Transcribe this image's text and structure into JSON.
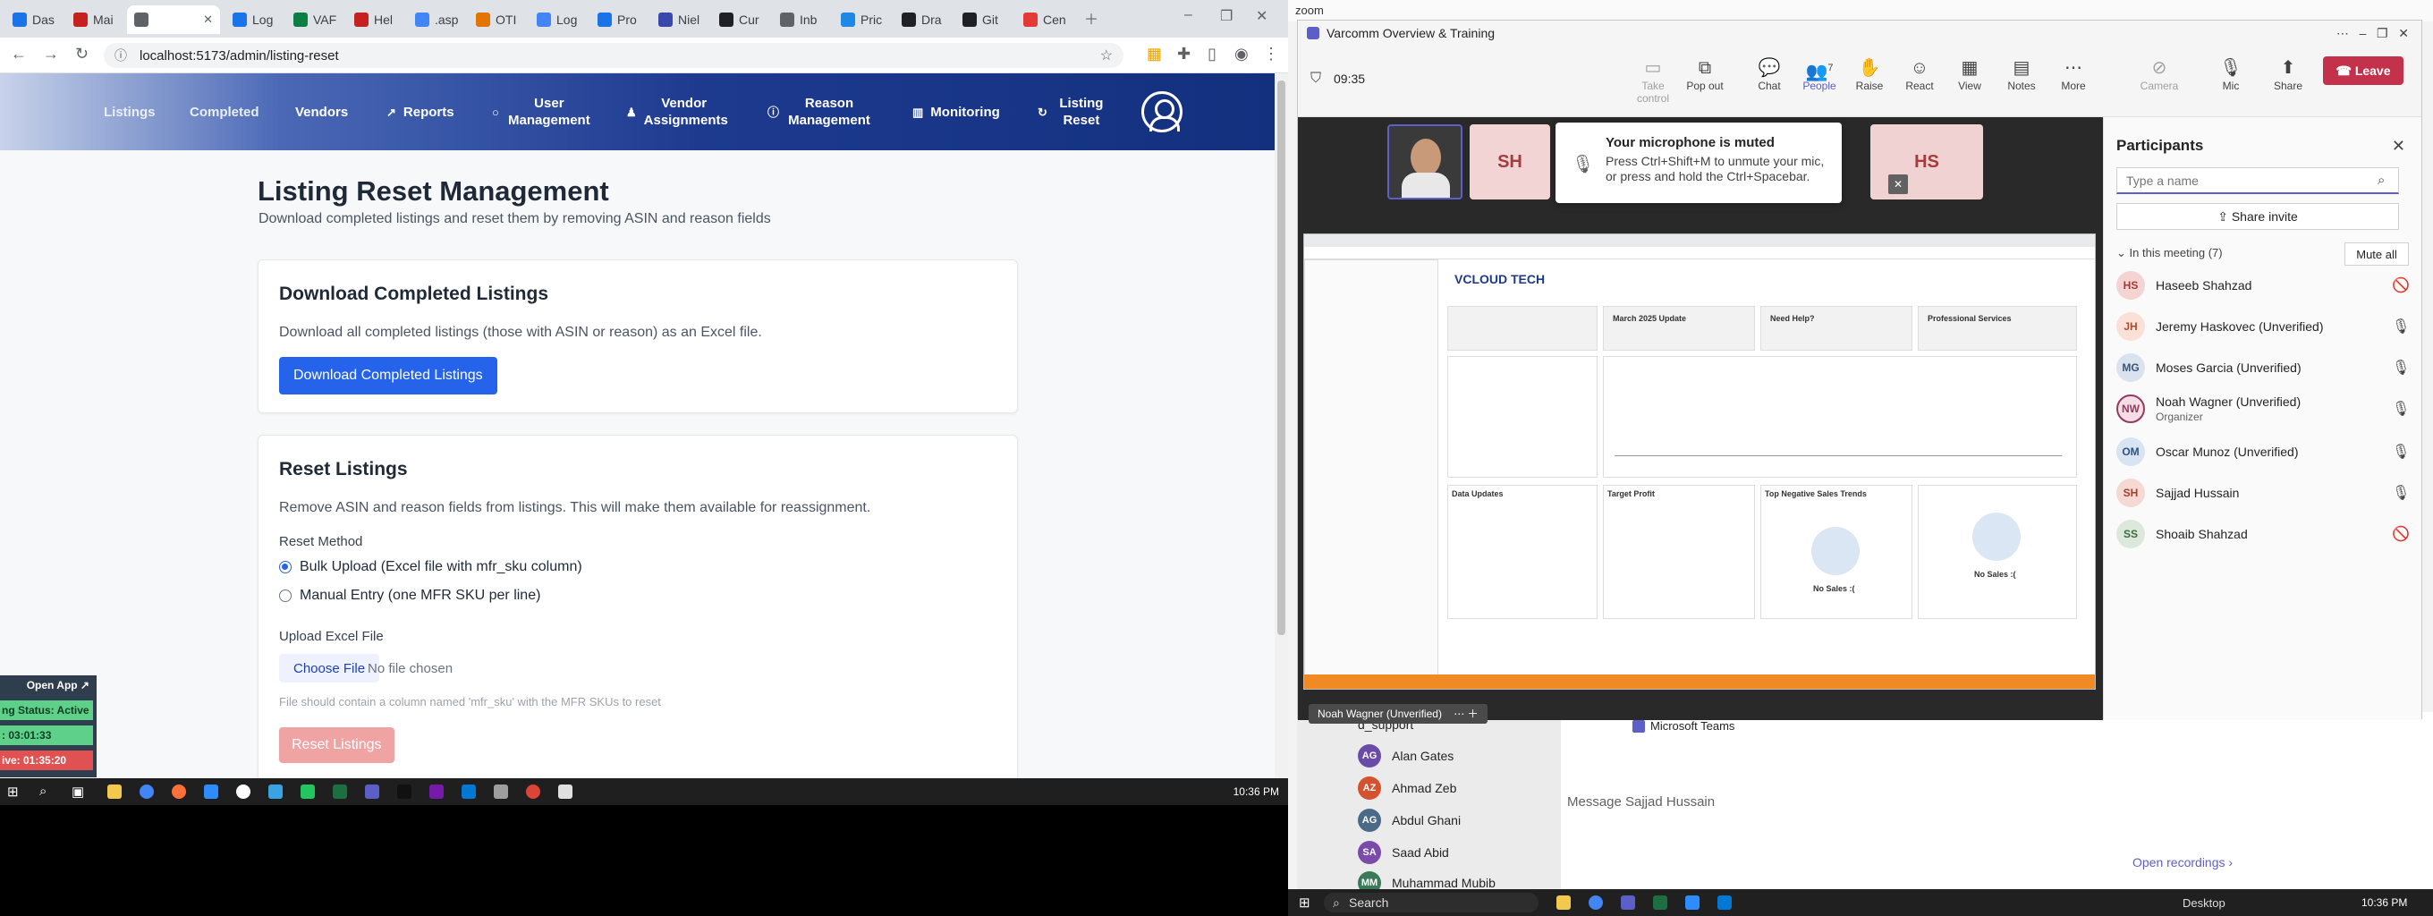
{
  "browser": {
    "tabs": [
      {
        "label": "Das",
        "color": "#1a73e8"
      },
      {
        "label": "Mai",
        "color": "#c5221f"
      },
      {
        "label": "",
        "color": "#5f6368",
        "active": true
      },
      {
        "label": "Log",
        "color": "#1a73e8"
      },
      {
        "label": "VAF",
        "color": "#0b8043"
      },
      {
        "label": "Hel",
        "color": "#c5221f"
      },
      {
        "label": ".asp",
        "color": "#4285f4"
      },
      {
        "label": "OTI",
        "color": "#e37400"
      },
      {
        "label": "Log",
        "color": "#4285f4"
      },
      {
        "label": "Pro",
        "color": "#1a73e8"
      },
      {
        "label": "Niel",
        "color": "#3949ab"
      },
      {
        "label": "Cur",
        "color": "#202124"
      },
      {
        "label": "Inb",
        "color": "#5f6368"
      },
      {
        "label": "Pric",
        "color": "#1e88e5"
      },
      {
        "label": "Dra",
        "color": "#202124"
      },
      {
        "label": "Git",
        "color": "#202124"
      },
      {
        "label": "Cen",
        "color": "#e53935"
      }
    ],
    "url": "localhost:5173/admin/listing-reset",
    "window_controls": [
      "–",
      "❐",
      "✕"
    ]
  },
  "nav": {
    "items": [
      {
        "label": "Listings"
      },
      {
        "label": "Completed"
      },
      {
        "label": "Vendors"
      },
      {
        "label": "Reports",
        "icon": "chart-icon"
      },
      {
        "label": "User Management",
        "icon": "user-icon"
      },
      {
        "label": "Vendor Assignments",
        "icon": "user-icon"
      },
      {
        "label": "Reason Management",
        "icon": "info-icon"
      },
      {
        "label": "Monitoring",
        "icon": "bar-chart-icon"
      },
      {
        "label": "Listing Reset",
        "icon": "refresh-icon"
      }
    ]
  },
  "page": {
    "title": "Listing Reset Management",
    "subtitle": "Download completed listings and reset them by removing ASIN and reason fields",
    "download_card": {
      "heading": "Download Completed Listings",
      "description": "Download all completed listings (those with ASIN or reason) as an Excel file.",
      "button": "Download Completed Listings"
    },
    "reset_card": {
      "heading": "Reset Listings",
      "description": "Remove ASIN and reason fields from listings. This will make them available for reassignment.",
      "method_label": "Reset Method",
      "methods": [
        {
          "label": "Bulk Upload (Excel file with mfr_sku column)",
          "selected": true
        },
        {
          "label": "Manual Entry (one MFR SKU per line)",
          "selected": false
        }
      ],
      "upload_label": "Upload Excel File",
      "choose_file": "Choose File",
      "no_file": "No file chosen",
      "hint": "File should contain a column named 'mfr_sku' with the MFR SKUs to reset",
      "reset_button": "Reset Listings"
    }
  },
  "status_widget": {
    "open_app": "Open App ↗",
    "status": "ng Status: Active",
    "timer1": ": 03:01:33",
    "timer2": "ive: 01:35:20"
  },
  "taskbar_left": {
    "time": "10:36 PM"
  },
  "zoom_bg": {
    "title": "zoom"
  },
  "meeting": {
    "title": "Varcomm Overview & Training",
    "timer": "09:35",
    "toolbar": [
      {
        "label": "Take control",
        "glyph": "▭",
        "disabled": true
      },
      {
        "label": "Pop out",
        "glyph": "⧉"
      },
      {
        "label": "Chat",
        "glyph": "💬"
      },
      {
        "label": "People",
        "glyph": "👥",
        "badge": "7"
      },
      {
        "label": "Raise",
        "glyph": "✋"
      },
      {
        "label": "React",
        "glyph": "☺"
      },
      {
        "label": "View",
        "glyph": "▦"
      },
      {
        "label": "Notes",
        "glyph": "▤"
      },
      {
        "label": "More",
        "glyph": "⋯"
      },
      {
        "label": "Camera",
        "glyph": "⊘",
        "disabled": true
      },
      {
        "label": "Mic",
        "glyph": "🎙"
      },
      {
        "label": "Share",
        "glyph": "⬆"
      }
    ],
    "leave": "Leave",
    "video_tiles": [
      {
        "initials": "SH"
      },
      {
        "initials": "HS"
      }
    ],
    "toast": {
      "title": "Your microphone is muted",
      "body": "Press Ctrl+Shift+M to unmute your mic, or press and hold the Ctrl+Spacebar."
    },
    "shared": {
      "brand": "VCLOUD TECH",
      "tiles": [
        "March 2025 Update",
        "Need Help?",
        "Professional Services"
      ],
      "no_sales_1": "No Sales :(",
      "no_sales_2": "No Sales :(",
      "data_updates": "Data Updates",
      "target_profit": "Target Profit",
      "top_negative": "Top Negative Sales Trends"
    },
    "presenter": "Noah Wagner (Unverified)"
  },
  "participants": {
    "title": "Participants",
    "search_placeholder": "Type a name",
    "share_invite": "Share invite",
    "in_meeting": "In this meeting (7)",
    "mute_all": "Mute all",
    "list": [
      {
        "initials": "HS",
        "name": "Haseeb Shahzad",
        "muted": true,
        "color": "#f6d3d3",
        "text": "#9e3a3a"
      },
      {
        "initials": "JH",
        "name": "Jeremy Haskovec (Unverified)",
        "muted": false,
        "color": "#fbe0d8",
        "text": "#b14a2c"
      },
      {
        "initials": "MG",
        "name": "Moses Garcia (Unverified)",
        "muted": false,
        "color": "#d9e2ee",
        "text": "#3a5377"
      },
      {
        "initials": "NW",
        "name": "Noah Wagner (Unverified)",
        "role": "Organizer",
        "muted": false,
        "color": "#f5dde6",
        "text": "#933a62"
      },
      {
        "initials": "OM",
        "name": "Oscar Munoz (Unverified)",
        "muted": false,
        "color": "#d8e4f2",
        "text": "#2c5187"
      },
      {
        "initials": "SH",
        "name": "Sajjad Hussain",
        "muted": false,
        "color": "#f6d9d3",
        "text": "#a0402e"
      },
      {
        "initials": "SS",
        "name": "Shoaib Shahzad",
        "muted": true,
        "color": "#dde8dd",
        "text": "#3e6a3e"
      }
    ]
  },
  "teams_bg": {
    "contacts": [
      {
        "initials": "d",
        "name": "d_support",
        "color": "#8a8a8a"
      },
      {
        "initials": "AG",
        "name": "Alan Gates",
        "color": "#6b4ba8"
      },
      {
        "initials": "AZ",
        "name": "Ahmad Zeb",
        "color": "#d35230"
      },
      {
        "initials": "AG",
        "name": "Abdul Ghani",
        "color": "#4b6a88"
      },
      {
        "initials": "SA",
        "name": "Saad Abid",
        "color": "#7a4ba8"
      },
      {
        "initials": "MM",
        "name": "Muhammad Mubib",
        "color": "#3b7a57"
      }
    ],
    "message_placeholder": "Message Sajjad Hussain",
    "ms_teams": "Microsoft Teams",
    "open_recordings": "Open recordings ›"
  },
  "taskbar_right": {
    "search": "Search",
    "desktop": "Desktop",
    "time": "10:36 PM"
  }
}
